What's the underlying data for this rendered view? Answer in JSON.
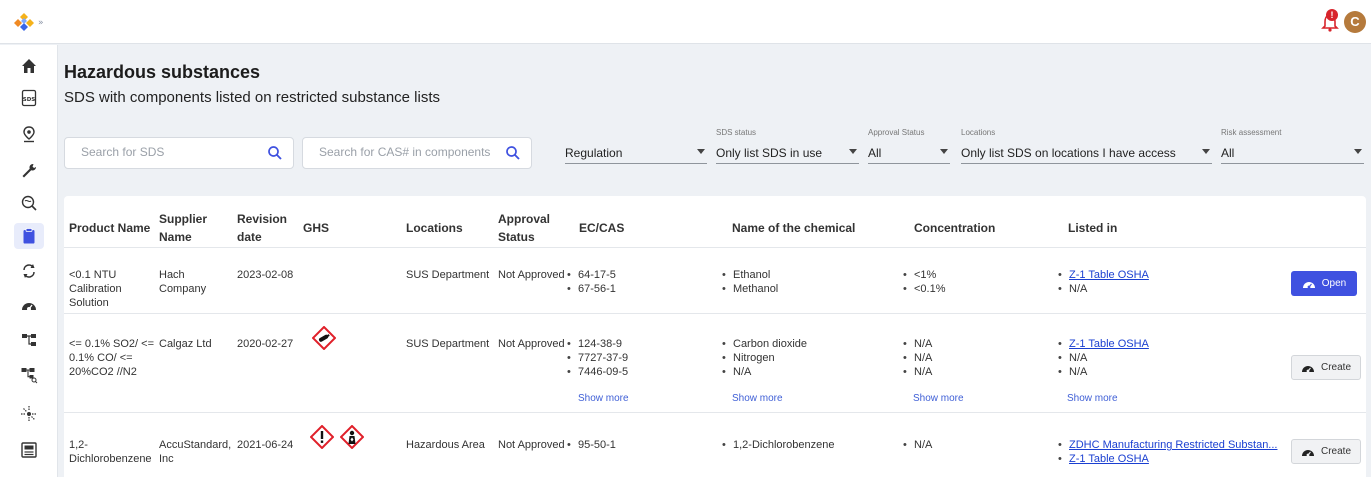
{
  "header": {
    "notification_count": "!",
    "avatar_initial": "C"
  },
  "page": {
    "title": "Hazardous substances",
    "subtitle": "SDS with components listed on restricted substance lists"
  },
  "search": {
    "sds_placeholder": "Search for SDS",
    "cas_placeholder": "Search for CAS# in components"
  },
  "filters": {
    "regulation": {
      "label": "",
      "value": "Regulation"
    },
    "sds_status": {
      "label": "SDS status",
      "value": "Only list SDS in use"
    },
    "approval_status": {
      "label": "Approval Status",
      "value": "All"
    },
    "locations": {
      "label": "Locations",
      "value": "Only list SDS on locations I have access"
    },
    "risk_assessment": {
      "label": "Risk assessment",
      "value": "All"
    }
  },
  "table": {
    "columns": {
      "product": "Product Name",
      "supplier": "Supplier Name",
      "revision": "Revision date",
      "ghs": "GHS",
      "locations": "Locations",
      "approval": "Approval Status",
      "ec_cas": "EC/CAS",
      "chemical": "Name of the chemical",
      "concentration": "Concentration",
      "listed_in": "Listed in"
    },
    "rows": [
      {
        "product": "<0.1 NTU Calibration Solution",
        "supplier": "Hach Company",
        "revision": "2023-02-08",
        "ghs": [],
        "location": "SUS Department",
        "approval": "Not Approved",
        "cas": [
          "64-17-5",
          "67-56-1"
        ],
        "chemicals": [
          "Ethanol",
          "Methanol"
        ],
        "concentration": [
          "<1%",
          "<0.1%"
        ],
        "listed_in": [
          "Z-1 Table OSHA",
          "N/A"
        ],
        "action": "Open"
      },
      {
        "product": "<= 0.1% SO2/ <= 0.1% CO/ <= 20%CO2 //N2",
        "supplier": "Calgaz Ltd",
        "revision": "2020-02-27",
        "ghs": [
          "gas-cylinder"
        ],
        "location": "SUS Department",
        "approval": "Not Approved",
        "cas": [
          "124-38-9",
          "7727-37-9",
          "7446-09-5"
        ],
        "chemicals": [
          "Carbon dioxide",
          "Nitrogen",
          "N/A"
        ],
        "concentration": [
          "N/A",
          "N/A",
          "N/A"
        ],
        "listed_in": [
          "Z-1 Table OSHA",
          "N/A",
          "N/A"
        ],
        "show_more": "Show more",
        "action": "Create"
      },
      {
        "product": "1,2-Dichlorobenzene",
        "supplier": "AccuStandard, Inc",
        "revision": "2021-06-24",
        "ghs": [
          "exclamation",
          "health-hazard"
        ],
        "location": "Hazardous Area",
        "approval": "Not Approved",
        "cas": [
          "95-50-1"
        ],
        "chemicals": [
          "1,2-Dichlorobenzene"
        ],
        "concentration": [
          "N/A"
        ],
        "listed_in": [
          "ZDHC Manufacturing Restricted Substan...",
          "Z-1 Table OSHA"
        ],
        "action": "Create"
      }
    ]
  },
  "colors": {
    "accent": "#3f51e0",
    "link": "#1a3fd1",
    "ghs_red": "#e0202a"
  }
}
